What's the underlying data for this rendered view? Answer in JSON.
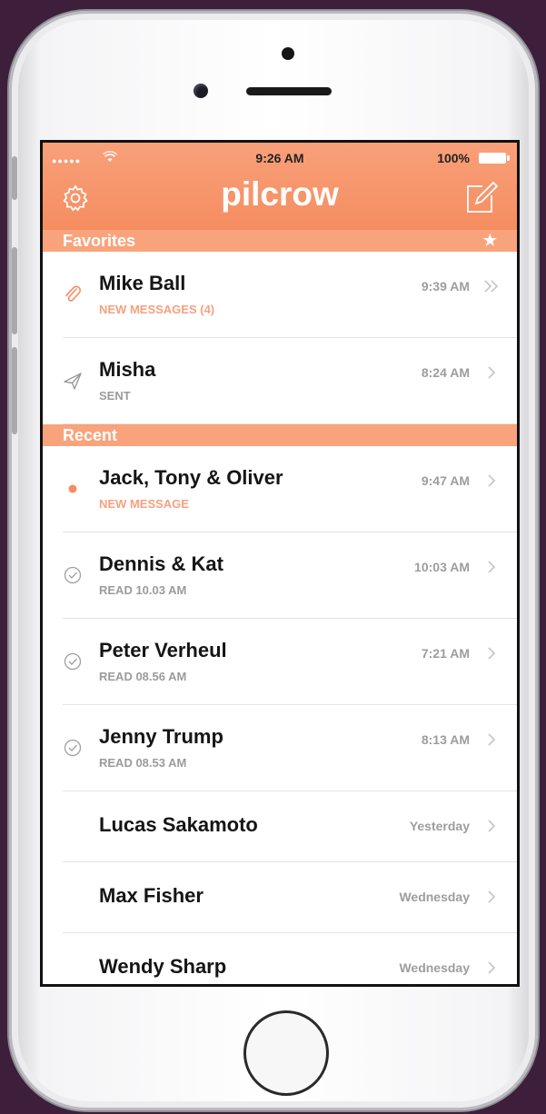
{
  "status_bar": {
    "time": "9:26 AM",
    "battery": "100%"
  },
  "app": {
    "title": "pilcrow"
  },
  "sections": {
    "favorites": "Favorites",
    "recent": "Recent"
  },
  "favorites": [
    {
      "name": "Mike Ball",
      "sub": "NEW MESSAGES (4)",
      "time": "9:39 AM",
      "icon": "paperclip-icon"
    },
    {
      "name": "Misha",
      "sub": "SENT",
      "time": "8:24 AM",
      "icon": "paper-plane-icon"
    }
  ],
  "recent": [
    {
      "name": "Jack, Tony & Oliver",
      "sub": "NEW MESSAGE",
      "time": "9:47 AM",
      "icon": "unread-dot-icon"
    },
    {
      "name": "Dennis & Kat",
      "sub": "READ 10.03 AM",
      "time": "10:03 AM",
      "icon": "read-check-icon"
    },
    {
      "name": "Peter Verheul",
      "sub": "READ 08.56 AM",
      "time": "7:21 AM",
      "icon": "read-check-icon"
    },
    {
      "name": "Jenny Trump",
      "sub": "READ 08.53 AM",
      "time": "8:13 AM",
      "icon": "read-check-icon"
    },
    {
      "name": "Lucas Sakamoto",
      "sub": "",
      "time": "Yesterday",
      "icon": ""
    },
    {
      "name": "Max Fisher",
      "sub": "",
      "time": "Wednesday",
      "icon": ""
    },
    {
      "name": "Wendy Sharp",
      "sub": "",
      "time": "Wednesday",
      "icon": ""
    }
  ],
  "colors": {
    "accent": "#f58d60",
    "section_bg": "#f9a37c",
    "background": "#3d1f3b"
  }
}
